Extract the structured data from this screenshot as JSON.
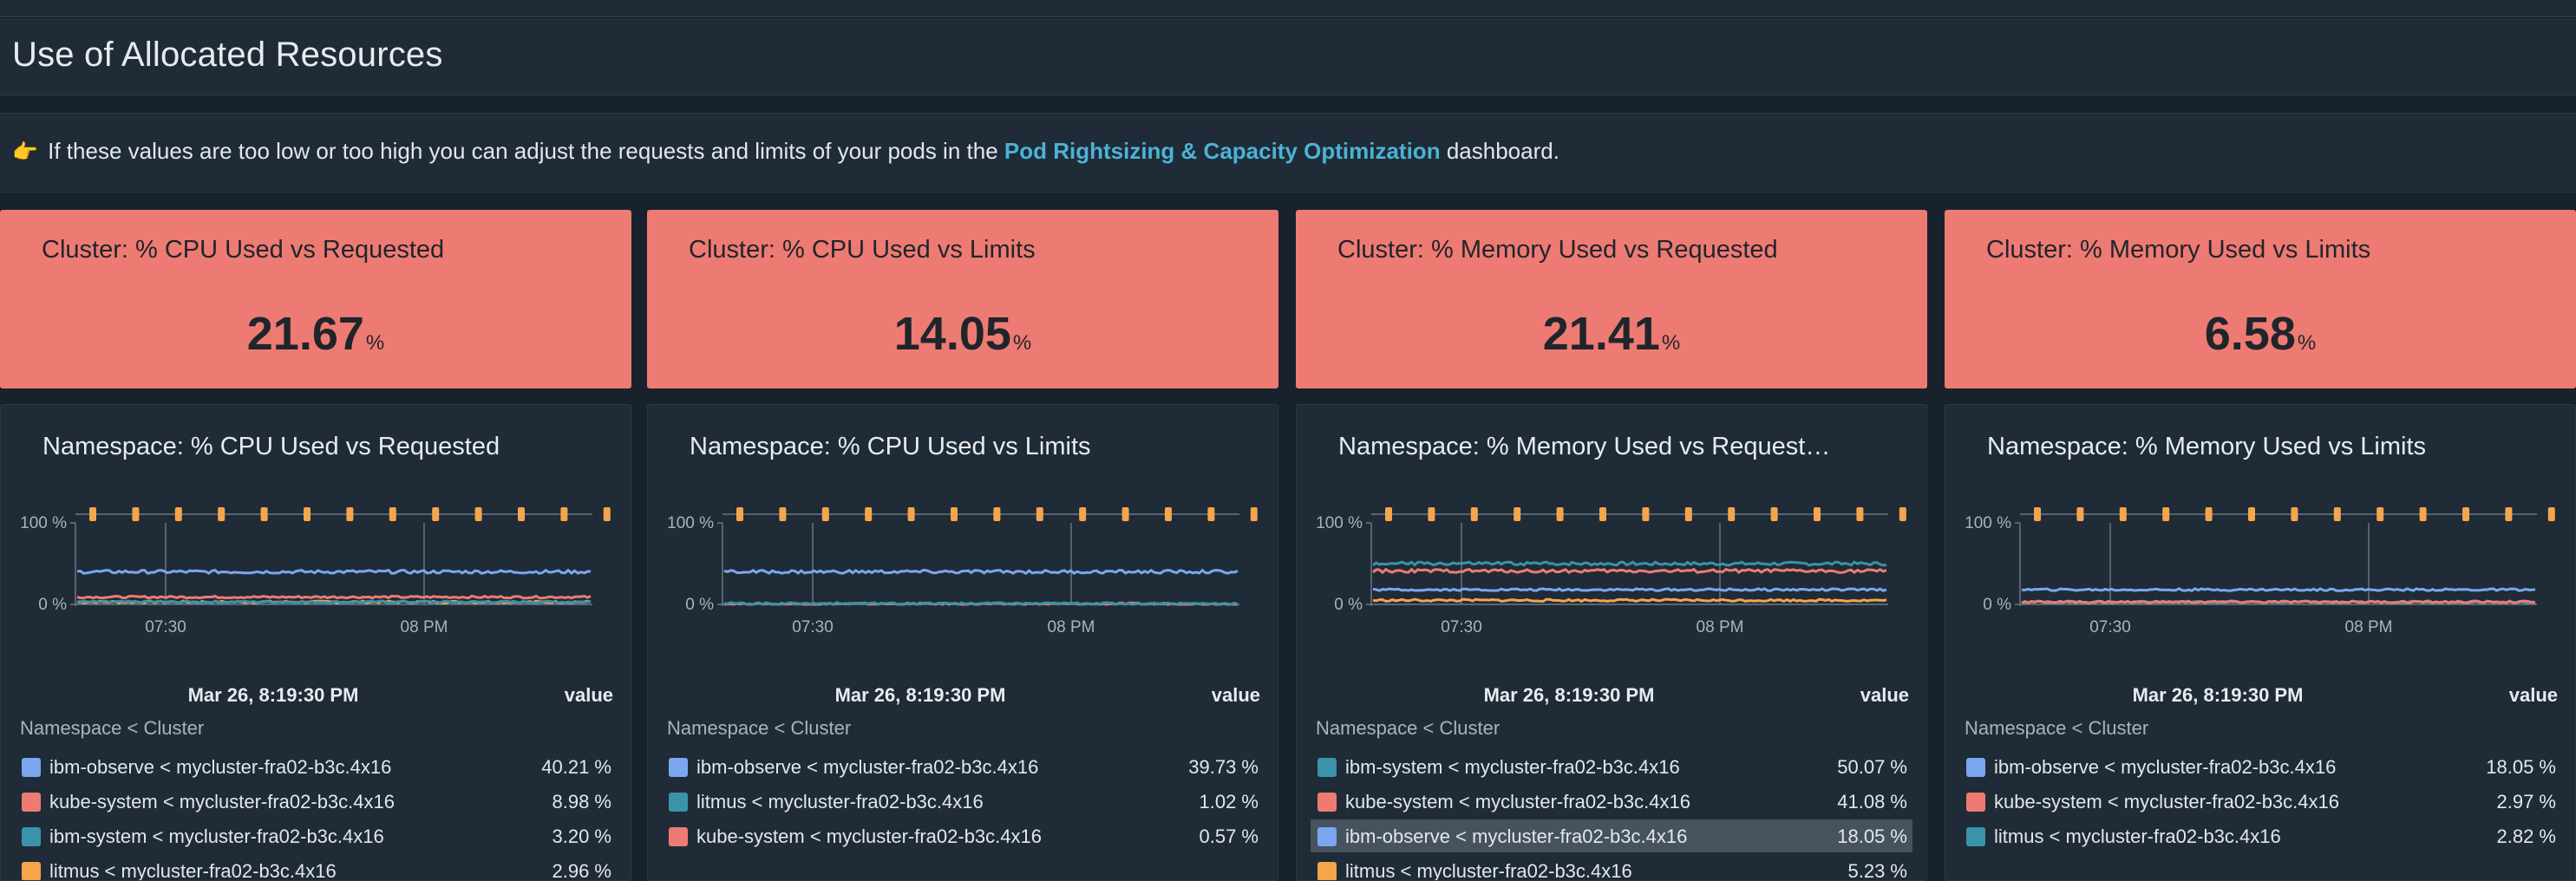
{
  "section_title": "Use of Allocated Resources",
  "info": {
    "hand_emoji": "👉",
    "text_before": "If these values are too low or too high you can adjust the requests and limits of your pods in the",
    "link": "Pod Rightsizing & Capacity Optimization",
    "text_after": "dashboard."
  },
  "stats": [
    {
      "title": "Cluster: % CPU Used vs Requested",
      "value": "21.67",
      "unit": "%"
    },
    {
      "title": "Cluster: % CPU Used vs Limits",
      "value": "14.05",
      "unit": "%"
    },
    {
      "title": "Cluster: % Memory Used vs Requested",
      "value": "21.41",
      "unit": "%"
    },
    {
      "title": "Cluster: % Memory Used vs Limits",
      "value": "6.58",
      "unit": "%"
    }
  ],
  "colors": {
    "stat_bg": "#ee7b73",
    "blue": "#7aa7ef",
    "red": "#ee7b73",
    "teal": "#3a93a8",
    "orange": "#f5a54a",
    "link": "#4bb3d6"
  },
  "panels": [
    {
      "title": "Namespace: % CPU Used vs Requested",
      "timestamp": "Mar 26, 8:19:30 PM",
      "value_header": "value",
      "subheader": "Namespace < Cluster",
      "rows": [
        {
          "name": "ibm-observe < mycluster-fra02-b3c.4x16",
          "value": "40.21 %",
          "color": "#7aa7ef"
        },
        {
          "name": "kube-system < mycluster-fra02-b3c.4x16",
          "value": "8.98 %",
          "color": "#ee7b73"
        },
        {
          "name": "ibm-system < mycluster-fra02-b3c.4x16",
          "value": "3.20 %",
          "color": "#3a93a8"
        },
        {
          "name": "litmus < mycluster-fra02-b3c.4x16",
          "value": "2.96 %",
          "color": "#f5a54a"
        }
      ]
    },
    {
      "title": "Namespace: % CPU Used vs Limits",
      "timestamp": "Mar 26, 8:19:30 PM",
      "value_header": "value",
      "subheader": "Namespace < Cluster",
      "rows": [
        {
          "name": "ibm-observe < mycluster-fra02-b3c.4x16",
          "value": "39.73 %",
          "color": "#7aa7ef"
        },
        {
          "name": "litmus < mycluster-fra02-b3c.4x16",
          "value": "1.02 %",
          "color": "#3a93a8"
        },
        {
          "name": "kube-system < mycluster-fra02-b3c.4x16",
          "value": "0.57 %",
          "color": "#ee7b73"
        }
      ]
    },
    {
      "title": "Namespace: % Memory Used vs Request…",
      "timestamp": "Mar 26, 8:19:30 PM",
      "value_header": "value",
      "subheader": "Namespace < Cluster",
      "rows": [
        {
          "name": "ibm-system < mycluster-fra02-b3c.4x16",
          "value": "50.07 %",
          "color": "#3a93a8"
        },
        {
          "name": "kube-system < mycluster-fra02-b3c.4x16",
          "value": "41.08 %",
          "color": "#ee7b73"
        },
        {
          "name": "ibm-observe < mycluster-fra02-b3c.4x16",
          "value": "18.05 %",
          "color": "#7aa7ef",
          "highlighted": true
        },
        {
          "name": "litmus < mycluster-fra02-b3c.4x16",
          "value": "5.23 %",
          "color": "#f5a54a"
        }
      ]
    },
    {
      "title": "Namespace: % Memory Used vs Limits",
      "timestamp": "Mar 26, 8:19:30 PM",
      "value_header": "value",
      "subheader": "Namespace < Cluster",
      "rows": [
        {
          "name": "ibm-observe < mycluster-fra02-b3c.4x16",
          "value": "18.05 %",
          "color": "#7aa7ef"
        },
        {
          "name": "kube-system < mycluster-fra02-b3c.4x16",
          "value": "2.97 %",
          "color": "#ee7b73"
        },
        {
          "name": "litmus < mycluster-fra02-b3c.4x16",
          "value": "2.82 %",
          "color": "#3a93a8"
        }
      ]
    }
  ],
  "chart_data": [
    {
      "type": "line",
      "y_tick_labels": [
        "100 %",
        "0 %"
      ],
      "x_tick_labels": [
        "07:30",
        "08 PM"
      ],
      "ylim": [
        0,
        100
      ],
      "series": [
        {
          "name": "ibm-observe < mycluster-fra02-b3c.4x16",
          "color": "#7aa7ef",
          "level": 40
        },
        {
          "name": "kube-system < mycluster-fra02-b3c.4x16",
          "color": "#ee7b73",
          "level": 9
        },
        {
          "name": "ibm-system < mycluster-fra02-b3c.4x16",
          "color": "#3a93a8",
          "level": 3
        },
        {
          "name": "litmus < mycluster-fra02-b3c.4x16",
          "color": "#f5a54a",
          "level": 3
        }
      ]
    },
    {
      "type": "line",
      "y_tick_labels": [
        "100 %",
        "0 %"
      ],
      "x_tick_labels": [
        "07:30",
        "08 PM"
      ],
      "ylim": [
        0,
        100
      ],
      "series": [
        {
          "name": "ibm-observe < mycluster-fra02-b3c.4x16",
          "color": "#7aa7ef",
          "level": 40
        },
        {
          "name": "litmus < mycluster-fra02-b3c.4x16",
          "color": "#3a93a8",
          "level": 1
        },
        {
          "name": "kube-system < mycluster-fra02-b3c.4x16",
          "color": "#ee7b73",
          "level": 0.6
        }
      ]
    },
    {
      "type": "line",
      "y_tick_labels": [
        "100 %",
        "0 %"
      ],
      "x_tick_labels": [
        "07:30",
        "08 PM"
      ],
      "ylim": [
        0,
        100
      ],
      "series": [
        {
          "name": "ibm-system < mycluster-fra02-b3c.4x16",
          "color": "#3a93a8",
          "level": 50
        },
        {
          "name": "kube-system < mycluster-fra02-b3c.4x16",
          "color": "#ee7b73",
          "level": 41
        },
        {
          "name": "ibm-observe < mycluster-fra02-b3c.4x16",
          "color": "#7aa7ef",
          "level": 18
        },
        {
          "name": "litmus < mycluster-fra02-b3c.4x16",
          "color": "#f5a54a",
          "level": 5
        }
      ]
    },
    {
      "type": "line",
      "y_tick_labels": [
        "100 %",
        "0 %"
      ],
      "x_tick_labels": [
        "07:30",
        "08 PM"
      ],
      "ylim": [
        0,
        100
      ],
      "series": [
        {
          "name": "ibm-observe < mycluster-fra02-b3c.4x16",
          "color": "#7aa7ef",
          "level": 18
        },
        {
          "name": "kube-system < mycluster-fra02-b3c.4x16",
          "color": "#ee7b73",
          "level": 3
        },
        {
          "name": "litmus < mycluster-fra02-b3c.4x16",
          "color": "#3a93a8",
          "level": 2.8
        }
      ]
    }
  ]
}
